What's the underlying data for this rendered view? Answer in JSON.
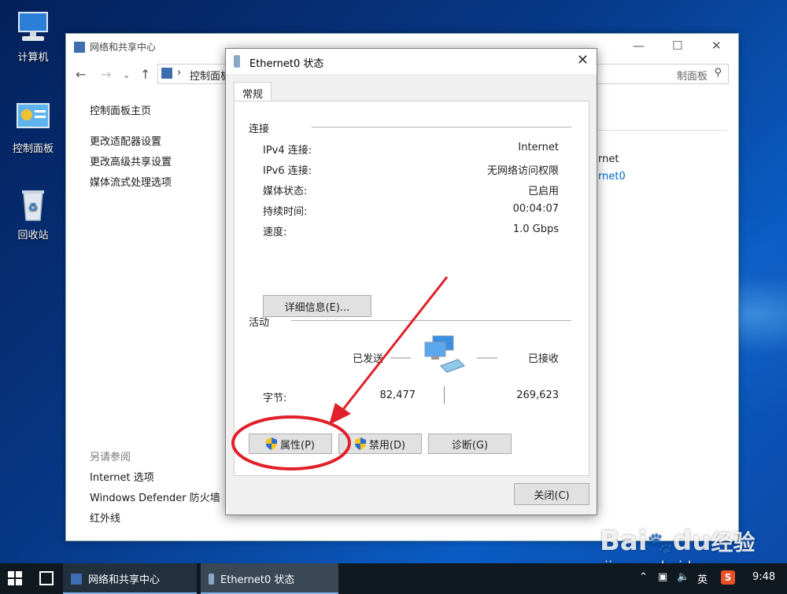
{
  "desktop": {
    "icons": [
      {
        "label": "计算机"
      },
      {
        "label": "控制面板"
      },
      {
        "label": "回收站"
      }
    ]
  },
  "explorer": {
    "title": "网络和共享中心",
    "address_text": "控制面板",
    "address_right": "制面板",
    "left_links": [
      "控制面板主页",
      "更改适配器设置",
      "更改高级共享设置",
      "媒体流式处理选项"
    ],
    "see_also_title": "另请参阅",
    "see_also": [
      "Internet 选项",
      "Windows Defender 防火墙",
      "红外线"
    ],
    "right_line1": "rnet",
    "right_line2": "rnet0"
  },
  "dialog": {
    "title": "Ethernet0 状态",
    "tab": "常规",
    "connection_group": "连接",
    "rows": [
      {
        "label": "IPv4 连接:",
        "value": "Internet"
      },
      {
        "label": "IPv6 连接:",
        "value": "无网络访问权限"
      },
      {
        "label": "媒体状态:",
        "value": "已启用"
      },
      {
        "label": "持续时间:",
        "value": "00:04:07"
      },
      {
        "label": "速度:",
        "value": "1.0 Gbps"
      }
    ],
    "details_button": "详细信息(E)...",
    "activity_group": "活动",
    "sent_label": "已发送",
    "received_label": "已接收",
    "bytes_label": "字节:",
    "bytes_sent": "82,477",
    "bytes_received": "269,623",
    "properties_button": "属性(P)",
    "disable_button": "禁用(D)",
    "diagnose_button": "诊断(G)",
    "close_button": "关闭(C)"
  },
  "taskbar": {
    "items": [
      "网络和共享中心",
      "Ethernet0 状态"
    ],
    "ime": "英",
    "ime_s": "S",
    "time": "9:48"
  },
  "watermark": {
    "logo_baidu": "Bai",
    "logo_du": "du",
    "logo_jingyan": "经验",
    "url": "jingyan.baidu.com"
  },
  "colors": {
    "accent": "#0066cc",
    "annotation_red": "#e0202a",
    "taskbar": "#101820"
  }
}
